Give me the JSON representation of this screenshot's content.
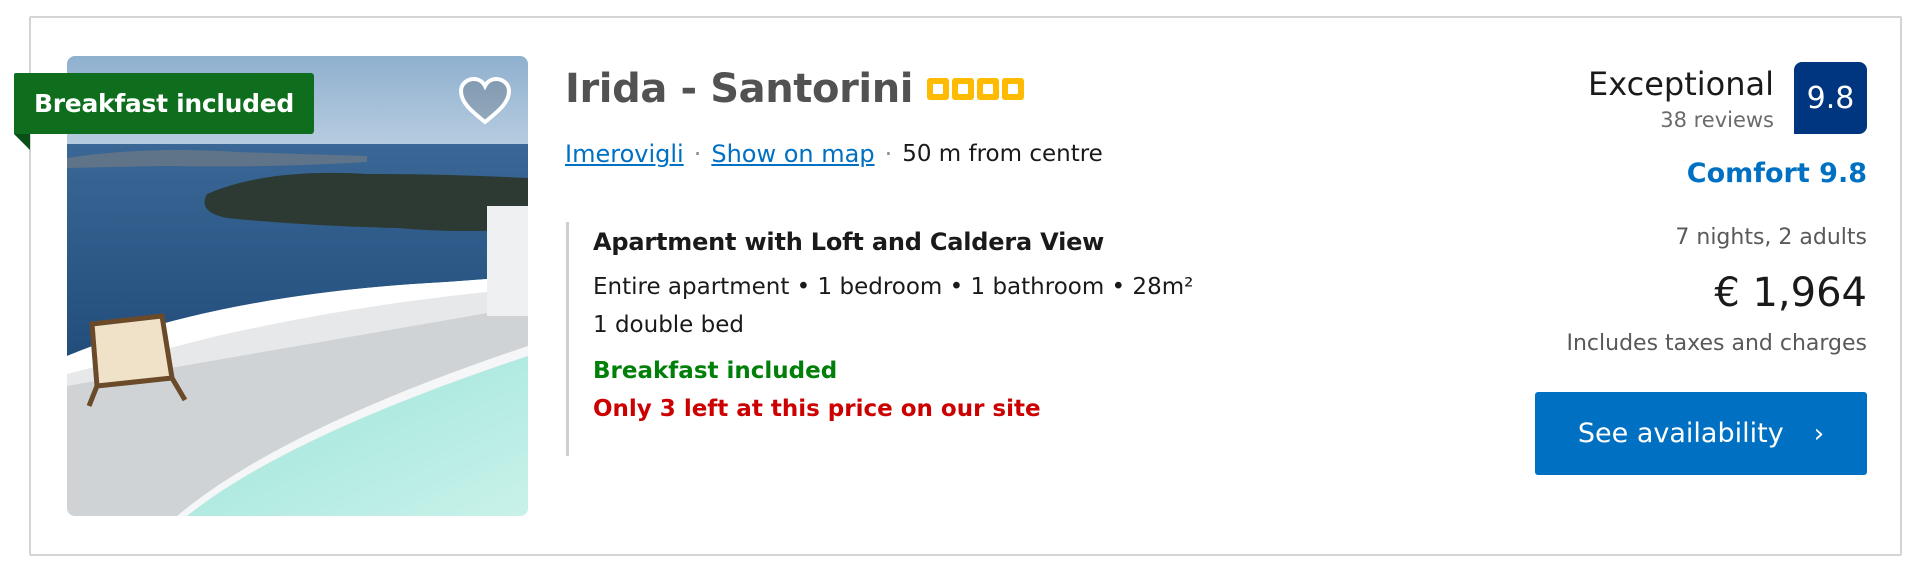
{
  "badge": {
    "label": "Breakfast included"
  },
  "hotel": {
    "name": "Irida - Santorini",
    "star_count": 4,
    "location": "Imerovigli",
    "map_link": "Show on map",
    "separator": "·",
    "distance": "50 m from centre"
  },
  "room": {
    "title": "Apartment with Loft and Caldera View",
    "facts": "Entire apartment • 1 bedroom • 1 bathroom • 28m²",
    "bed": "1 double bed",
    "meal": "Breakfast included",
    "availability": "Only 3 left at this price on our site"
  },
  "review": {
    "word": "Exceptional",
    "count": "38 reviews",
    "score": "9.8",
    "comfort": "Comfort 9.8"
  },
  "pricing": {
    "stay": "7 nights, 2 adults",
    "price": "€ 1,964",
    "taxes": "Includes taxes and charges"
  },
  "cta": {
    "label": "See availability",
    "chevron": "›"
  },
  "colors": {
    "badge_green": "#0f6e1e",
    "link_blue": "#0071c2",
    "score_navy": "#003580",
    "meal_green": "#008009",
    "alert_red": "#cc0000",
    "star_yellow": "#febb02"
  },
  "icons": {
    "wishlist": "heart-icon",
    "stars": "star-box-icon",
    "cta": "chevron-right-icon"
  }
}
